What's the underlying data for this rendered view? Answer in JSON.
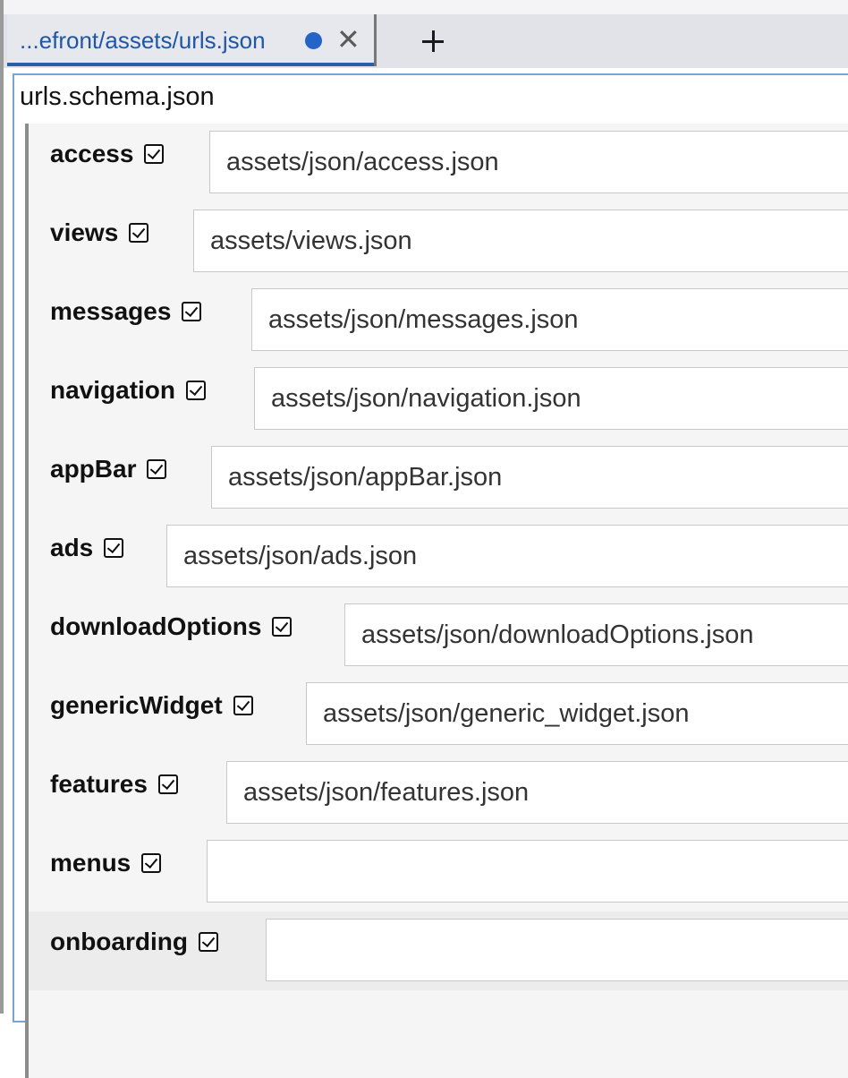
{
  "tab": {
    "title": "...efront/assets/urls.json",
    "close_glyph": "✕",
    "modified_indicator": "unsaved-dot",
    "new_tab_icon": "plus-icon"
  },
  "editor": {
    "schema_title": "urls.schema.json",
    "properties": [
      {
        "label": "access",
        "value": "assets/json/access.json",
        "checked": true
      },
      {
        "label": "views",
        "value": "assets/views.json",
        "checked": true
      },
      {
        "label": "messages",
        "value": "assets/json/messages.json",
        "checked": true
      },
      {
        "label": "navigation",
        "value": "assets/json/navigation.json",
        "checked": true
      },
      {
        "label": "appBar",
        "value": "assets/json/appBar.json",
        "checked": true
      },
      {
        "label": "ads",
        "value": "assets/json/ads.json",
        "checked": true
      },
      {
        "label": "downloadOptions",
        "value": "assets/json/downloadOptions.json",
        "checked": true
      },
      {
        "label": "genericWidget",
        "value": "assets/json/generic_widget.json",
        "checked": true
      },
      {
        "label": "features",
        "value": "assets/json/features.json",
        "checked": true
      },
      {
        "label": "menus",
        "value": "",
        "checked": true
      },
      {
        "label": "onboarding",
        "value": "",
        "checked": true
      }
    ]
  },
  "colors": {
    "tab_text": "#1f57a6",
    "tab_underline": "#2a5fa8",
    "modified_dot": "#2563c9",
    "editor_border": "#7aa3d6"
  }
}
